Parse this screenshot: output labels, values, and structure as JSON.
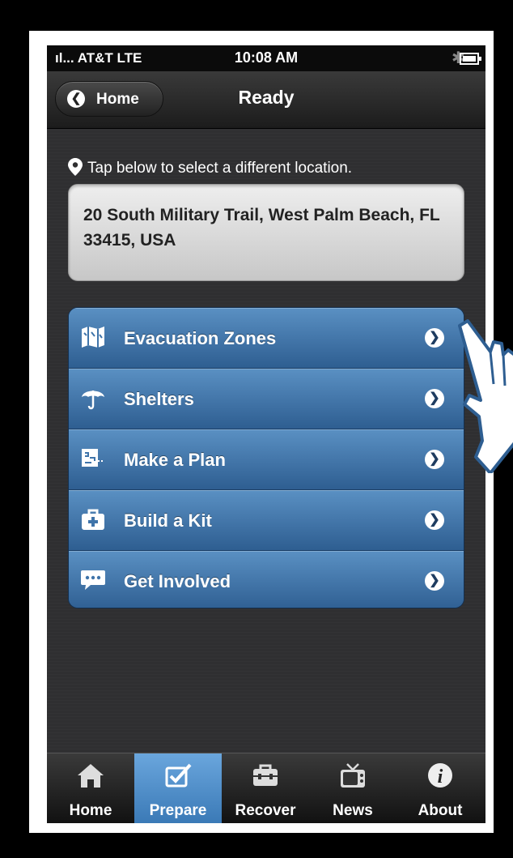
{
  "status_bar": {
    "carrier": "ıl... AT&T  LTE",
    "time": "10:08 AM"
  },
  "nav_bar": {
    "back_label": "Home",
    "back_icon": "chevron-left-icon",
    "title": "Ready"
  },
  "location": {
    "hint": "Tap below to select a different location.",
    "hint_icon": "map-pin-icon",
    "address": "20 South Military Trail, West Palm Beach, FL 33415, USA"
  },
  "menu": {
    "items": [
      {
        "label": "Evacuation Zones",
        "icon": "map-icon"
      },
      {
        "label": "Shelters",
        "icon": "umbrella-icon"
      },
      {
        "label": "Make a Plan",
        "icon": "plan-icon"
      },
      {
        "label": "Build a Kit",
        "icon": "first-aid-kit-icon"
      },
      {
        "label": "Get Involved",
        "icon": "chat-bubble-icon"
      }
    ],
    "accent": "#3f74aa"
  },
  "tab_bar": {
    "tabs": [
      {
        "label": "Home",
        "icon": "house-icon"
      },
      {
        "label": "Prepare",
        "icon": "checkbox-icon",
        "active": true
      },
      {
        "label": "Recover",
        "icon": "toolbox-icon"
      },
      {
        "label": "News",
        "icon": "tv-icon"
      },
      {
        "label": "About",
        "icon": "info-icon"
      }
    ],
    "active_color": "#4a8cc9"
  }
}
